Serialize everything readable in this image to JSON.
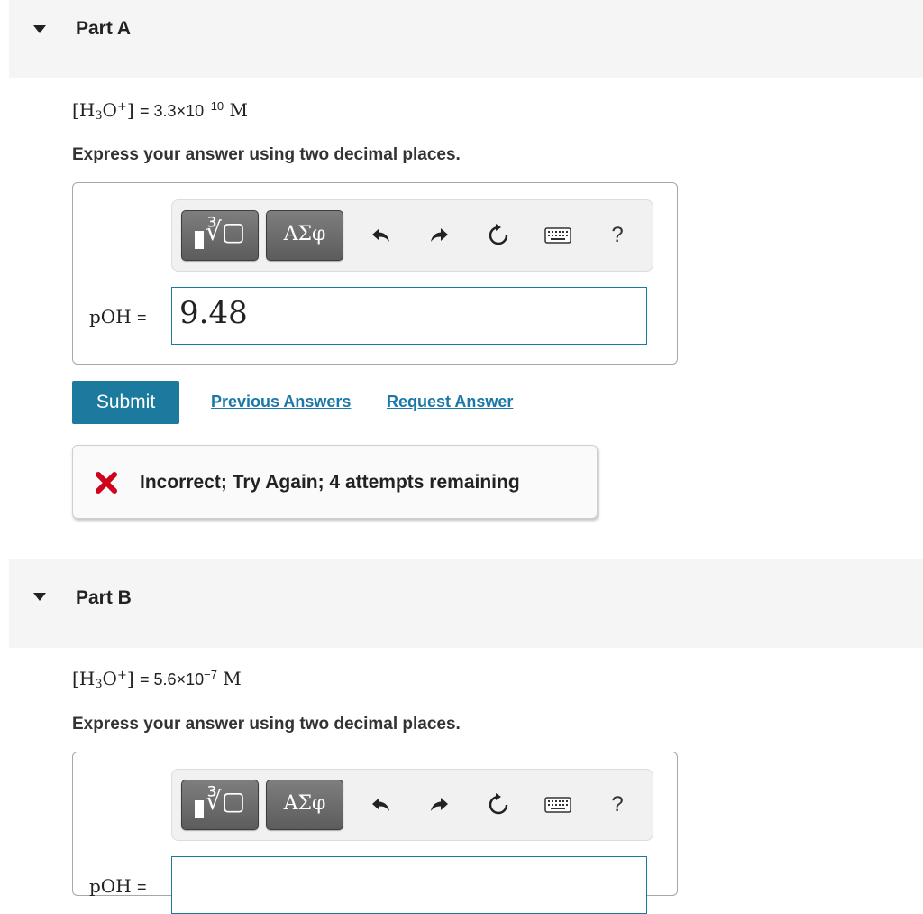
{
  "part_a": {
    "title": "Part A",
    "question": {
      "lhs_base": "H",
      "lhs_sub": "3",
      "lhs_o": "O",
      "lhs_sup": "+",
      "rhs_mantissa": "= 3.3×10",
      "rhs_exponent": "−10",
      "rhs_unit": "M"
    },
    "instruction": "Express your answer using two decimal places.",
    "toolbar": {
      "greek_label": "ΑΣφ",
      "help_label": "?"
    },
    "answer_label": "pOH",
    "answer_equals": "=",
    "answer_value": "9.48",
    "submit_label": "Submit",
    "previous_answers_label": "Previous Answers",
    "request_answer_label": "Request Answer",
    "feedback_message": "Incorrect; Try Again; 4 attempts remaining"
  },
  "part_b": {
    "title": "Part B",
    "question": {
      "lhs_base": "H",
      "lhs_sub": "3",
      "lhs_o": "O",
      "lhs_sup": "+",
      "rhs_mantissa": "= 5.6×10",
      "rhs_exponent": "−7",
      "rhs_unit": "M"
    },
    "instruction": "Express your answer using two decimal places.",
    "toolbar": {
      "greek_label": "ΑΣφ",
      "help_label": "?"
    },
    "answer_label": "pOH",
    "answer_equals": "=",
    "answer_value": ""
  },
  "colors": {
    "submit_bg": "#1b7a9e",
    "link": "#1b78a8",
    "error_x": "#d0021b",
    "input_border": "#1a7a9a"
  },
  "icons": [
    "chevron-down-icon",
    "template-icon",
    "greek-letters-icon",
    "undo-icon",
    "redo-icon",
    "reset-icon",
    "keyboard-icon",
    "help-icon",
    "incorrect-x-icon"
  ]
}
